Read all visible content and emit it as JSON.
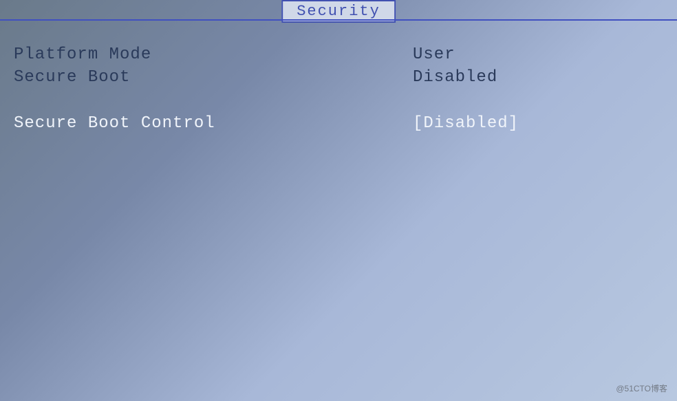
{
  "tab": {
    "label": "Security"
  },
  "rows": {
    "platform_mode": {
      "label": "Platform Mode",
      "value": "User"
    },
    "secure_boot": {
      "label": "Secure Boot",
      "value": "Disabled"
    },
    "secure_boot_control": {
      "label": "Secure Boot Control",
      "value": "[Disabled]"
    }
  },
  "watermark": "@51CTO博客"
}
